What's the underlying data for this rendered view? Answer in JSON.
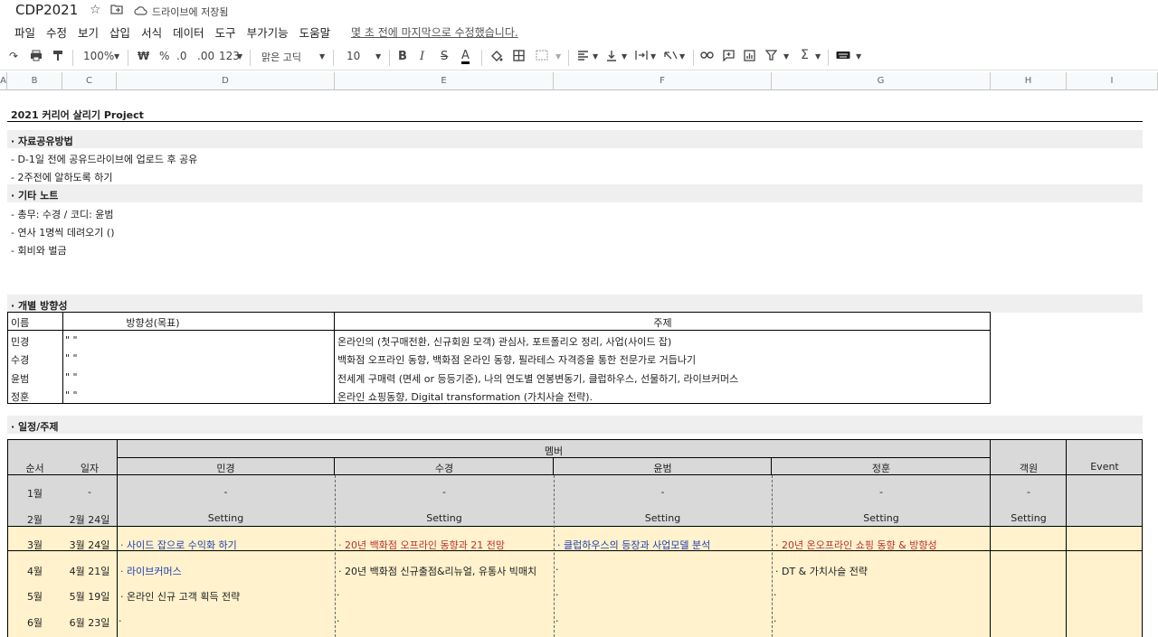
{
  "doc": {
    "title": "CDP2021",
    "saved_status": "드라이브에 저장됨",
    "last_edit": "몇 초 전에 마지막으로 수정했습니다."
  },
  "menu": [
    "파일",
    "수정",
    "보기",
    "삽입",
    "서식",
    "데이터",
    "도구",
    "부가기능",
    "도움말"
  ],
  "toolbar": {
    "zoom": "100%",
    "currency": "₩",
    "percent": "%",
    "dec_less": ".0",
    "dec_more": ".00",
    "format_more": "123",
    "font": "맑은 고딕",
    "size": "10",
    "bold": "B",
    "italic": "I",
    "strike": "S",
    "textcolor": "A",
    "sigma": "Σ"
  },
  "columns": [
    "A",
    "B",
    "C",
    "D",
    "E",
    "F",
    "G",
    "H",
    "I"
  ],
  "sheet": {
    "project_title": "2021 커리어 살리기 Project",
    "section1": "· 자료공유방법",
    "s1_line1": "- D-1일 전에 공유드라이브에 업로드 후 공유",
    "s1_line2": "- 2주전에 알하도록 하기",
    "section2": "· 기타 노트",
    "s2_line1": "- 총무: 수경 /  코디: 윤범",
    "s2_line2": "- 연사 1명씩 데려오기 ()",
    "s2_line3": "- 회비와 벌금",
    "section3": "· 개별 방향성",
    "dir_headers": {
      "name": "이름",
      "goal": "방향성(목표)",
      "topic": "주제"
    },
    "dir_rows": [
      {
        "name": "민경",
        "goal": "\"     \"",
        "topic": "온라인의 (첫구매전환, 신규회원 모객) 관심사, 포트폴리오 정리, 사업(사이드 잡)"
      },
      {
        "name": "수경",
        "goal": "\"     \"",
        "topic": "백화점 오프라인 동향, 백화점 온라인 동향, 필라테스 자격증을 통한 전문가로 거듭나기"
      },
      {
        "name": "윤범",
        "goal": "\"     \"",
        "topic": "전세계 구매력 (면세 or 등등기준), 나의 연도별  연봉변동기,  클럽하우스, 선물하기, 라이브커머스"
      },
      {
        "name": "정훈",
        "goal": "\"     \"",
        "topic": "온라인 쇼핑동향, Digital transformation (가치사슬 전략)."
      }
    ],
    "section4": "· 일정/주제",
    "sched_headers": {
      "order": "순서",
      "date": "일자",
      "member": "멤버",
      "guest": "객원",
      "event": "Event"
    },
    "members": [
      "민경",
      "수경",
      "윤범",
      "정훈"
    ],
    "sched_rows": [
      {
        "order": "1월",
        "date": "-",
        "cells": [
          "-",
          "-",
          "-",
          "-"
        ],
        "guest": "-"
      },
      {
        "order": "2월",
        "date": "2월 24일",
        "cells": [
          "Setting",
          "Setting",
          "Setting",
          "Setting"
        ],
        "guest": "Setting"
      },
      {
        "order": "3월",
        "date": "3월 24일",
        "cells": [
          "·  사이드 잡으로 수익화 하기",
          "· 20년 백화점 오프라인 동향과 21 전망",
          "· 클럽하우스의 등장과 사업모델 분석",
          "· 20년 온오프라인 쇼핑 동향 & 방향성"
        ],
        "guest": ""
      },
      {
        "order": "4월",
        "date": "4월 21일",
        "cells": [
          "· 라이브커머스",
          "· 20년 백화점 신규출점&리뉴얼, 유통사 빅매치",
          "·",
          "· DT & 가치사슬 전략"
        ],
        "guest": ""
      },
      {
        "order": "5월",
        "date": "5월 19일",
        "cells": [
          "· 온라인 신규 고객 획득 전략",
          "·",
          "·",
          "·"
        ],
        "guest": ""
      },
      {
        "order": "6월",
        "date": "6월 23일",
        "cells": [
          "·",
          "·",
          "·",
          "·"
        ],
        "guest": ""
      }
    ]
  }
}
